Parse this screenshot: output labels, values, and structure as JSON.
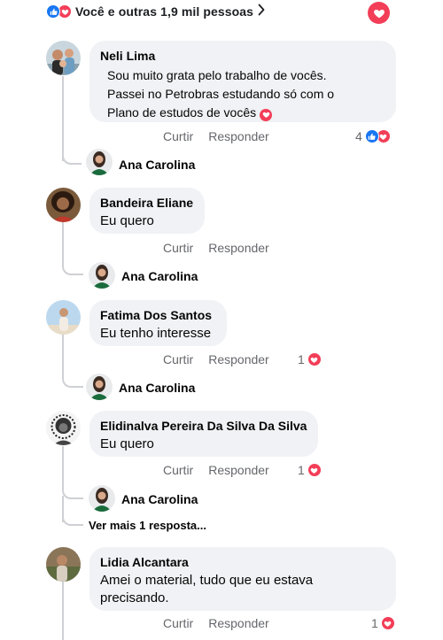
{
  "post_reactions": {
    "summary": "Você e outras 1,9 mil pessoas",
    "icons": [
      "like-icon",
      "love-icon"
    ]
  },
  "comments": [
    {
      "author": "Neli Lima",
      "text_lines": [
        "Sou muito grata pelo trabalho de vocês.",
        "Passei no Petrobras estudando só com o",
        "Plano de estudos de vocês"
      ],
      "like_label": "Curtir",
      "reply_label": "Responder",
      "reaction_count": "4",
      "reply_author": "Ana Carolina"
    },
    {
      "author": "Bandeira Eliane",
      "text": "Eu quero",
      "like_label": "Curtir",
      "reply_label": "Responder",
      "reply_author": "Ana Carolina"
    },
    {
      "author": "Fatima Dos Santos",
      "text": "Eu tenho interesse",
      "like_label": "Curtir",
      "reply_label": "Responder",
      "reaction_count": "1",
      "reply_author": "Ana Carolina"
    },
    {
      "author": "Elidinalva Pereira Da Silva Da Silva",
      "text": "Eu quero",
      "like_label": "Curtir",
      "reply_label": "Responder",
      "reaction_count": "1",
      "reply_author": "Ana Carolina",
      "more_replies": "Ver mais 1 resposta..."
    },
    {
      "author": "Lidia Alcantara",
      "text_lines": [
        "Amei o material, tudo que eu estava",
        "precisando."
      ],
      "like_label": "Curtir",
      "reply_label": "Responder",
      "reaction_count": "1"
    }
  ],
  "colors": {
    "like_blue": "#1877f2",
    "love_red": "#f33e58",
    "bubble_bg": "#f0f2f5",
    "secondary_text": "#65676b"
  }
}
